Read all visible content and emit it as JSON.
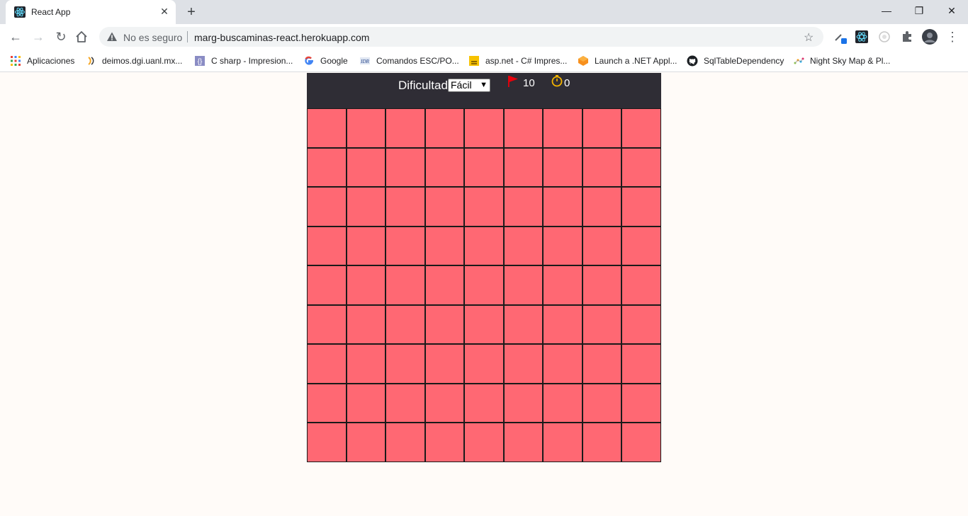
{
  "browser": {
    "tab_title": "React App",
    "tab_close": "✕",
    "new_tab": "+",
    "security_text": "No es seguro",
    "url": "marg-buscaminas-react.herokuapp.com",
    "window_controls": {
      "minimize": "—",
      "restore": "❐",
      "close": "✕"
    }
  },
  "bookmarks": [
    {
      "label": "Aplicaciones",
      "icon": "apps-grid-icon"
    },
    {
      "label": "deimos.dgi.uanl.mx...",
      "icon": "deimos-icon"
    },
    {
      "label": "C sharp - Impresion...",
      "icon": "csharp-icon"
    },
    {
      "label": "Google",
      "icon": "google-icon"
    },
    {
      "label": "Comandos ESC/PO...",
      "icon": "pos-icon"
    },
    {
      "label": "asp.net - C# Impres...",
      "icon": "stackoverflow-icon"
    },
    {
      "label": "Launch a .NET Appl...",
      "icon": "aws-icon"
    },
    {
      "label": "SqlTableDependency",
      "icon": "github-icon"
    },
    {
      "label": "Night Sky Map & Pl...",
      "icon": "nightsky-icon"
    }
  ],
  "game": {
    "difficulty_label": "Dificultad:",
    "difficulty_selected": "Fácil",
    "flag_count": "10",
    "timer": "0",
    "rows": 9,
    "cols": 9,
    "colors": {
      "header_bg": "#2f2d35",
      "cell": "#ff6873",
      "flag": "#e8000b",
      "timer": "#f5b400"
    }
  }
}
